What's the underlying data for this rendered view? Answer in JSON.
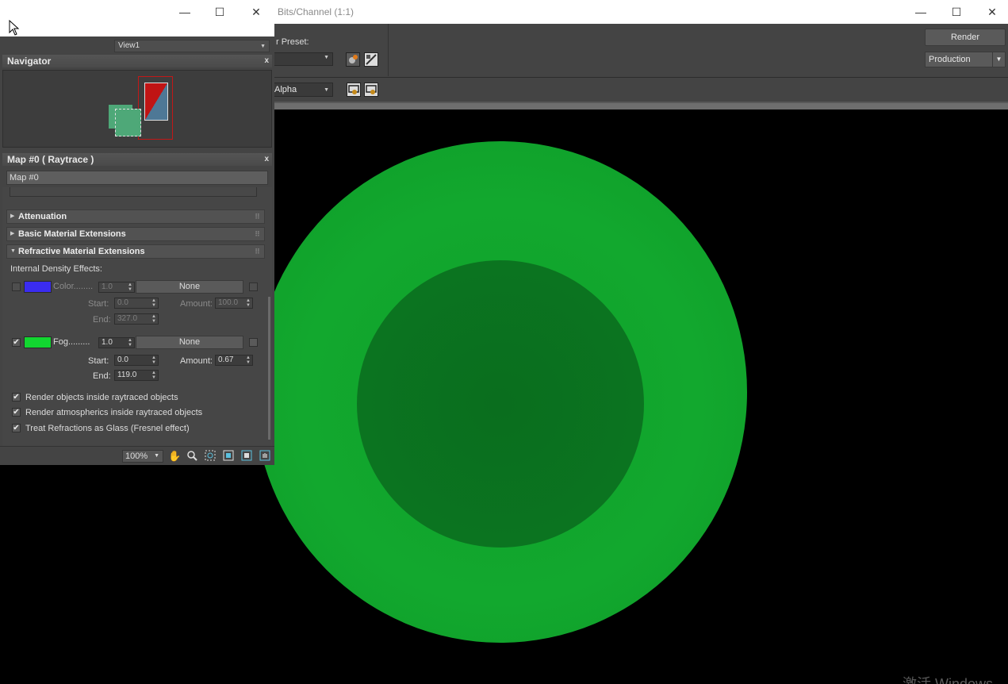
{
  "frame_buffer": {
    "title": "Bits/Channel (1:1)",
    "render_preset_label": "r Preset:",
    "render_button": "Render",
    "production_select": "Production",
    "channel_select": "Alpha",
    "sphere_outer_color": "#12a82e",
    "sphere_inner_color": "#0b7420",
    "watermark": "激活 Windows"
  },
  "material_editor": {
    "view_select": "View1",
    "navigator": {
      "title": "Navigator",
      "close": "x"
    },
    "map_panel": {
      "title": "Map #0  ( Raytrace )",
      "close": "x",
      "map_name": "Map #0",
      "rollouts": {
        "attenuation": "Attenuation",
        "basic_extensions": "Basic Material Extensions",
        "refractive_extensions": "Refractive Material Extensions"
      },
      "internal_density_label": "Internal Density Effects:",
      "color_effect": {
        "enabled": false,
        "swatch_color": "#3a2cf0",
        "label": "Color........",
        "value": "1.0",
        "map_button": "None",
        "start_label": "Start:",
        "start": "0.0",
        "amount_label": "Amount:",
        "amount": "100.0",
        "end_label": "End:",
        "end": "327.0"
      },
      "fog_effect": {
        "enabled": true,
        "swatch_color": "#12d630",
        "label": "Fog.........",
        "value": "1.0",
        "map_button": "None",
        "start_label": "Start:",
        "start": "0.0",
        "amount_label": "Amount:",
        "amount": "0.67",
        "end_label": "End:",
        "end": "119.0"
      },
      "options": [
        {
          "checked": true,
          "label": "Render objects inside raytraced objects"
        },
        {
          "checked": true,
          "label": "Render atmospherics inside raytraced objects"
        },
        {
          "checked": true,
          "label": "Treat Refractions as Glass (Fresnel effect)"
        }
      ]
    },
    "zoom": "100%"
  }
}
